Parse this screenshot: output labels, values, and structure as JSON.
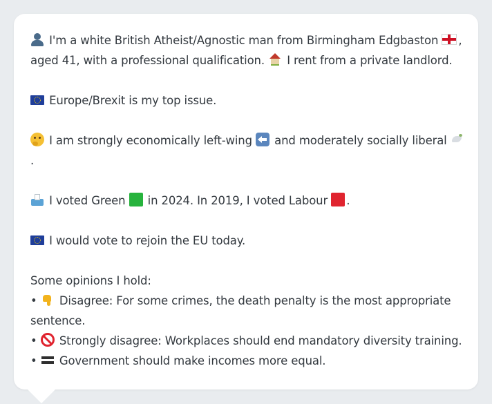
{
  "profile": {
    "intro_a": "I'm a white British Atheist/Agnostic man from Birmingham Edgbaston",
    "intro_b": ",",
    "intro_c": "aged 41, with a professional qualification.",
    "intro_d": "I rent from a private landlord.",
    "top_issue": "Europe/Brexit is my top issue.",
    "economics_a": "I am strongly economically left-wing",
    "economics_b": "and moderately socially liberal",
    "economics_c": ".",
    "vote_a": "I voted Green",
    "vote_b": "in 2024. In 2019, I voted Labour",
    "vote_c": ".",
    "rejoin": "I would vote to rejoin the EU today.",
    "opinions_heading": "Some opinions I hold:",
    "opinions": [
      {
        "bullet": "•",
        "text": "Disagree: For some crimes, the death penalty is the most appropriate sentence."
      },
      {
        "bullet": "•",
        "text": "Strongly disagree: Workplaces should end mandatory diversity training."
      },
      {
        "bullet": "•",
        "text": "Government should make incomes more equal."
      }
    ]
  },
  "icons": [
    "person-silhouette-icon",
    "england-flag-icon",
    "house-icon",
    "eu-flag-icon",
    "thinking-face-icon",
    "left-arrow-icon",
    "dove-icon",
    "ballot-box-icon",
    "green-square-icon",
    "red-square-icon",
    "thumbs-down-icon",
    "prohibited-icon",
    "equals-icon"
  ],
  "colors": {
    "background": "#e9ecef",
    "card": "#ffffff",
    "text": "#343a40"
  }
}
